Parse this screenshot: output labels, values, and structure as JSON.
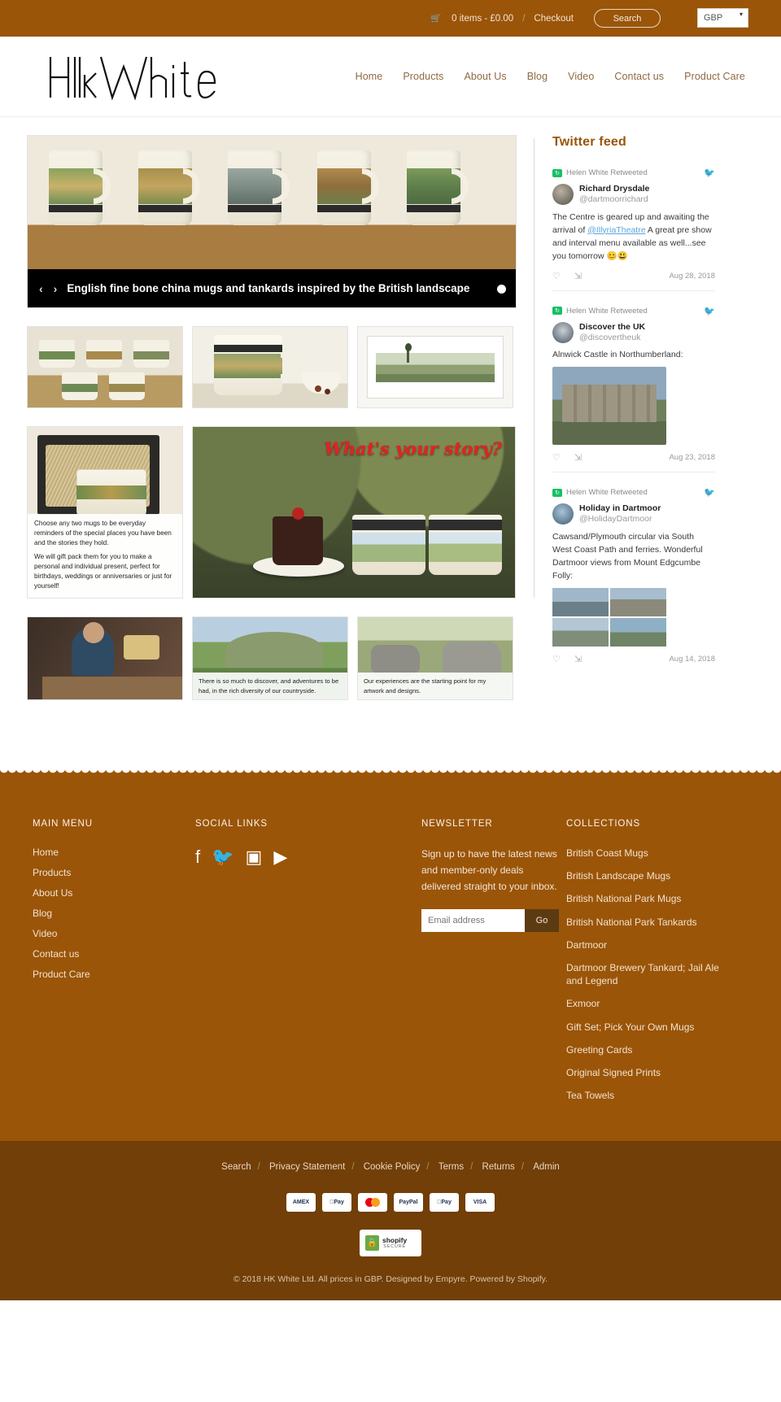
{
  "topbar": {
    "cart_icon": "cart-icon",
    "cart_text": "0 items - £0.00",
    "separator": "/",
    "checkout": "Checkout",
    "search_button": "Search",
    "currency": "GBP"
  },
  "header": {
    "logo_text": "HkWhite",
    "nav": [
      {
        "label": "Home"
      },
      {
        "label": "Products"
      },
      {
        "label": "About Us"
      },
      {
        "label": "Blog"
      },
      {
        "label": "Video"
      },
      {
        "label": "Contact us"
      },
      {
        "label": "Product Care"
      }
    ]
  },
  "hero": {
    "prev_arrow": "‹",
    "next_arrow": "›",
    "caption": "English fine bone china mugs and tankards inspired by the British landscape",
    "mug_labels": [
      "LAKE DISTRICT • LAK",
      "DISTRICT • PEAK",
      "DONIA • SNOWDO",
      "ARTMOOR • DAR",
      "YORKSHIRE D"
    ]
  },
  "promo": {
    "gift_line1": "Choose any two mugs to be everyday reminders of the special places you have been and the stories they hold.",
    "gift_line2": "We will gift pack them for you to make a personal and individual present, perfect for birthdays, weddings or anniversaries or just for yourself!",
    "story_headline": "What's your story?",
    "mug_label_left": "THE ROADS • THE",
    "mug_label_right": "PEAK DISTRICT • PEAK",
    "caption_countryside": "There is so much to discover, and adventures to be had, in the rich diversity of our countryside.",
    "caption_artwork": "Our experiences are the starting point for my artwork and designs."
  },
  "twitter": {
    "title": "Twitter feed",
    "retweet_label": "Helen White Retweeted",
    "tweets": [
      {
        "author": "Richard Drysdale",
        "handle": "@dartmoorrichard",
        "text_before": "The Centre is geared up and awaiting the arrival of ",
        "mention": "@IllyriaTheatre",
        "text_after": " A great pre show and interval menu available as well...see you tomorrow 😊😃",
        "date": "Aug 28, 2018",
        "media": "none"
      },
      {
        "author": "Discover the UK",
        "handle": "@discovertheuk",
        "text_before": "Alnwick Castle in Northumberland:",
        "mention": "",
        "text_after": "",
        "date": "Aug 23, 2018",
        "media": "single"
      },
      {
        "author": "Holiday in Dartmoor",
        "handle": "@HolidayDartmoor",
        "text_before": "Cawsand/Plymouth circular via South West Coast Path and ferries. Wonderful Dartmoor views from Mount Edgcumbe Folly:",
        "mention": "",
        "text_after": "",
        "date": "Aug 14, 2018",
        "media": "grid"
      }
    ],
    "like_icon": "heart-icon",
    "reply_icon": "reply-icon",
    "bird_icon": "twitter-bird-icon"
  },
  "footer": {
    "main_menu_heading": "MAIN MENU",
    "main_menu": [
      {
        "label": "Home"
      },
      {
        "label": "Products"
      },
      {
        "label": "About Us"
      },
      {
        "label": "Blog"
      },
      {
        "label": "Video"
      },
      {
        "label": "Contact us"
      },
      {
        "label": "Product Care"
      }
    ],
    "social_heading": "SOCIAL LINKS",
    "social": [
      {
        "name": "facebook-icon",
        "glyph": "f"
      },
      {
        "name": "twitter-icon",
        "glyph": "🐦"
      },
      {
        "name": "instagram-icon",
        "glyph": "▣"
      },
      {
        "name": "youtube-icon",
        "glyph": "▶"
      }
    ],
    "newsletter_heading": "NEWSLETTER",
    "newsletter_text": "Sign up to have the latest news and member-only deals delivered straight to your inbox.",
    "newsletter_placeholder": "Email address",
    "newsletter_button": "Go",
    "collections_heading": "COLLECTIONS",
    "collections": [
      {
        "label": "British Coast Mugs"
      },
      {
        "label": "British Landscape Mugs"
      },
      {
        "label": "British National Park Mugs"
      },
      {
        "label": "British National Park Tankards"
      },
      {
        "label": "Dartmoor"
      },
      {
        "label": "Dartmoor Brewery Tankard; Jail Ale and Legend"
      },
      {
        "label": "Exmoor"
      },
      {
        "label": "Gift Set; Pick Your Own Mugs"
      },
      {
        "label": "Greeting Cards"
      },
      {
        "label": "Original Signed Prints"
      },
      {
        "label": "Tea Towels"
      }
    ]
  },
  "footer_bottom": {
    "links": [
      {
        "label": "Search"
      },
      {
        "label": "Privacy Statement"
      },
      {
        "label": "Cookie Policy"
      },
      {
        "label": "Terms"
      },
      {
        "label": "Returns"
      },
      {
        "label": "Admin"
      }
    ],
    "separator": "/",
    "payments": [
      {
        "label": "AMEX"
      },
      {
        "label": "Pay"
      },
      {
        "label": "mastercard"
      },
      {
        "label": "PayPal"
      },
      {
        "label": "Pay"
      },
      {
        "label": "VISA"
      }
    ],
    "secure_badge_title": "shopify",
    "secure_badge_sub": "SECURE",
    "secure_lock_icon": "lock-icon",
    "copyright": "© 2018 HK White Ltd. All prices in GBP. Designed by Empyre. Powered by Shopify."
  },
  "colors": {
    "brand_brown": "#9a5509",
    "footer_bottom": "#713f07",
    "nav_link": "#8f6a43",
    "tweet_link": "#5aa5dd"
  }
}
